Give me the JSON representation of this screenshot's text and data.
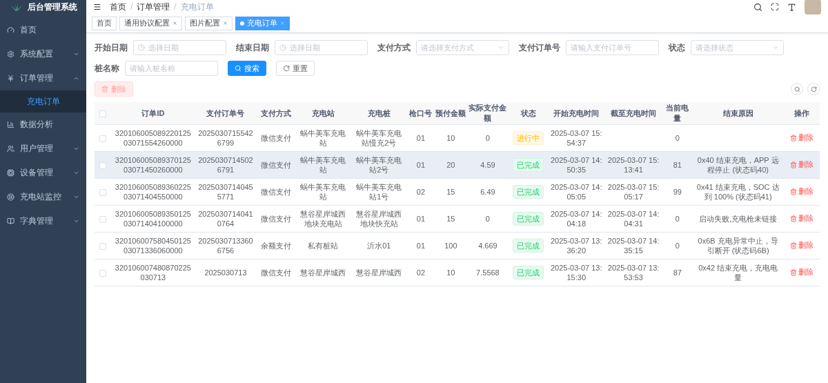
{
  "sidebar": {
    "title": "后台管理系统",
    "items": [
      {
        "label": "首页",
        "kind": "dashboard",
        "selected": false
      },
      {
        "label": "系统配置",
        "kind": "gear",
        "expanded": false,
        "selected": false
      },
      {
        "label": "订单管理",
        "kind": "yen",
        "expanded": true,
        "selected": false,
        "children": [
          {
            "label": "充电订单",
            "selected": true
          }
        ]
      },
      {
        "label": "数据分析",
        "kind": "chart",
        "selected": false
      },
      {
        "label": "用户管理",
        "kind": "user",
        "expanded": false,
        "selected": false
      },
      {
        "label": "设备管理",
        "kind": "device",
        "expanded": false,
        "selected": false
      },
      {
        "label": "充电站监控",
        "kind": "monitor",
        "expanded": false,
        "selected": false
      },
      {
        "label": "字典管理",
        "kind": "book",
        "expanded": false,
        "selected": false
      }
    ]
  },
  "breadcrumb": [
    "首页",
    "订单管理",
    "充电订单"
  ],
  "breadcrumb_separator": "/",
  "tabs": [
    {
      "label": "首页",
      "selected": false,
      "closable": false
    },
    {
      "label": "通用协议配置",
      "selected": false,
      "closable": true
    },
    {
      "label": "图片配置",
      "selected": false,
      "closable": true
    },
    {
      "label": "充电订单",
      "selected": true,
      "closable": true
    }
  ],
  "filters": [
    {
      "label": "开始日期",
      "kind": "date",
      "placeholder": "选择日期"
    },
    {
      "label": "结束日期",
      "kind": "date",
      "placeholder": "选择日期"
    },
    {
      "label": "支付方式",
      "kind": "select",
      "placeholder": "请选择支付方式"
    },
    {
      "label": "支付订单号",
      "kind": "input",
      "placeholder": "请输入支付订单号"
    },
    {
      "label": "状态",
      "kind": "select",
      "placeholder": "请选择状态"
    },
    {
      "label": "桩名称",
      "kind": "input",
      "placeholder": "请输入桩名称"
    }
  ],
  "search_button": "搜索",
  "reset_button": "重置",
  "delete_button": "删除",
  "table": {
    "select_all_checked": false,
    "columns": [
      "订单ID",
      "支付订单号",
      "支付方式",
      "充电站",
      "充电桩",
      "枪口号",
      "预付金额",
      "实际支付金额",
      "状态",
      "开始充电时间",
      "截至充电时间",
      "当前电量",
      "结束原因",
      "操作"
    ],
    "rows": [
      {
        "checked": false,
        "highlighted": false,
        "cells": [
          "32010600508922012503071554260000",
          "20250307155426799",
          "微信支付",
          "蜗牛美车充电站",
          "蜗牛美车充电站慢充2号",
          "01",
          "10",
          "0"
        ],
        "status": {
          "text": "进行中",
          "kind": "running"
        },
        "times": [
          "2025-03-07 15:54:37"
        ],
        "power": "0",
        "action": "删除"
      },
      {
        "checked": false,
        "highlighted": true,
        "cells": [
          "32010600508937012503071450260000",
          "20250307145026791",
          "微信支付",
          "蜗牛美车充电站",
          "蜗牛美车充电站2号",
          "01",
          "20",
          "4.59"
        ],
        "status": {
          "text": "已完成",
          "kind": "done"
        },
        "times": [
          "2025-03-07 14:50:35",
          "2025-03-07 15:13:41"
        ],
        "power": "81",
        "reason": "0x40 结束充电，APP 远程停止 (状态码40)",
        "action": "删除"
      },
      {
        "checked": false,
        "highlighted": false,
        "cells": [
          "32010600508936022503071404550000",
          "20250307140455771",
          "微信支付",
          "蜗牛美车充电站",
          "蜗牛美车充电站1号",
          "02",
          "15",
          "6.49"
        ],
        "status": {
          "text": "已完成",
          "kind": "done"
        },
        "times": [
          "2025-03-07 14:05:05",
          "2025-03-07 15:05:17"
        ],
        "power": "99",
        "reason": "0x41 结束充电，SOC 达到 100% (状态码41)",
        "action": "删除"
      },
      {
        "checked": false,
        "highlighted": false,
        "cells": [
          "32010600508935012503071404100000",
          "20250307140410764",
          "微信支付",
          "慧谷星岸城西地块充电站",
          "慧谷星岸城西地块快充站",
          "01",
          "15",
          "0"
        ],
        "status": {
          "text": "已完成",
          "kind": "done"
        },
        "times": [
          "2025-03-07 14:04:18",
          "2025-03-07 14:04:31"
        ],
        "power": "0",
        "reason": "启动失败,充电枪未链接",
        "action": "删除"
      },
      {
        "checked": false,
        "highlighted": false,
        "cells": [
          "32010600758045012503071336060000",
          "20250307133606756",
          "余额支付",
          "私有桩站",
          "沂水01",
          "01",
          "100",
          "4.669"
        ],
        "status": {
          "text": "已完成",
          "kind": "done"
        },
        "times": [
          "2025-03-07 13:36:20",
          "2025-03-07 14:35:15"
        ],
        "power": "0",
        "reason": "0x6B 充电异常中止，导引断开 (状态码6B)",
        "action": "删除"
      },
      {
        "checked": false,
        "highlighted": false,
        "cells": [
          "320106007480870225030713",
          "2025030713",
          "微信支付",
          "慧谷星岸城西",
          "慧谷星岸城西",
          "02",
          "10",
          "7.5568"
        ],
        "status": {
          "text": "已完成",
          "kind": "done"
        },
        "times": [
          "2025-03-07 13:15:30",
          "2025-03-07 13:53:53"
        ],
        "power": "87",
        "reason": "0x42 结束充电，充电电量",
        "action": "删除"
      }
    ]
  }
}
